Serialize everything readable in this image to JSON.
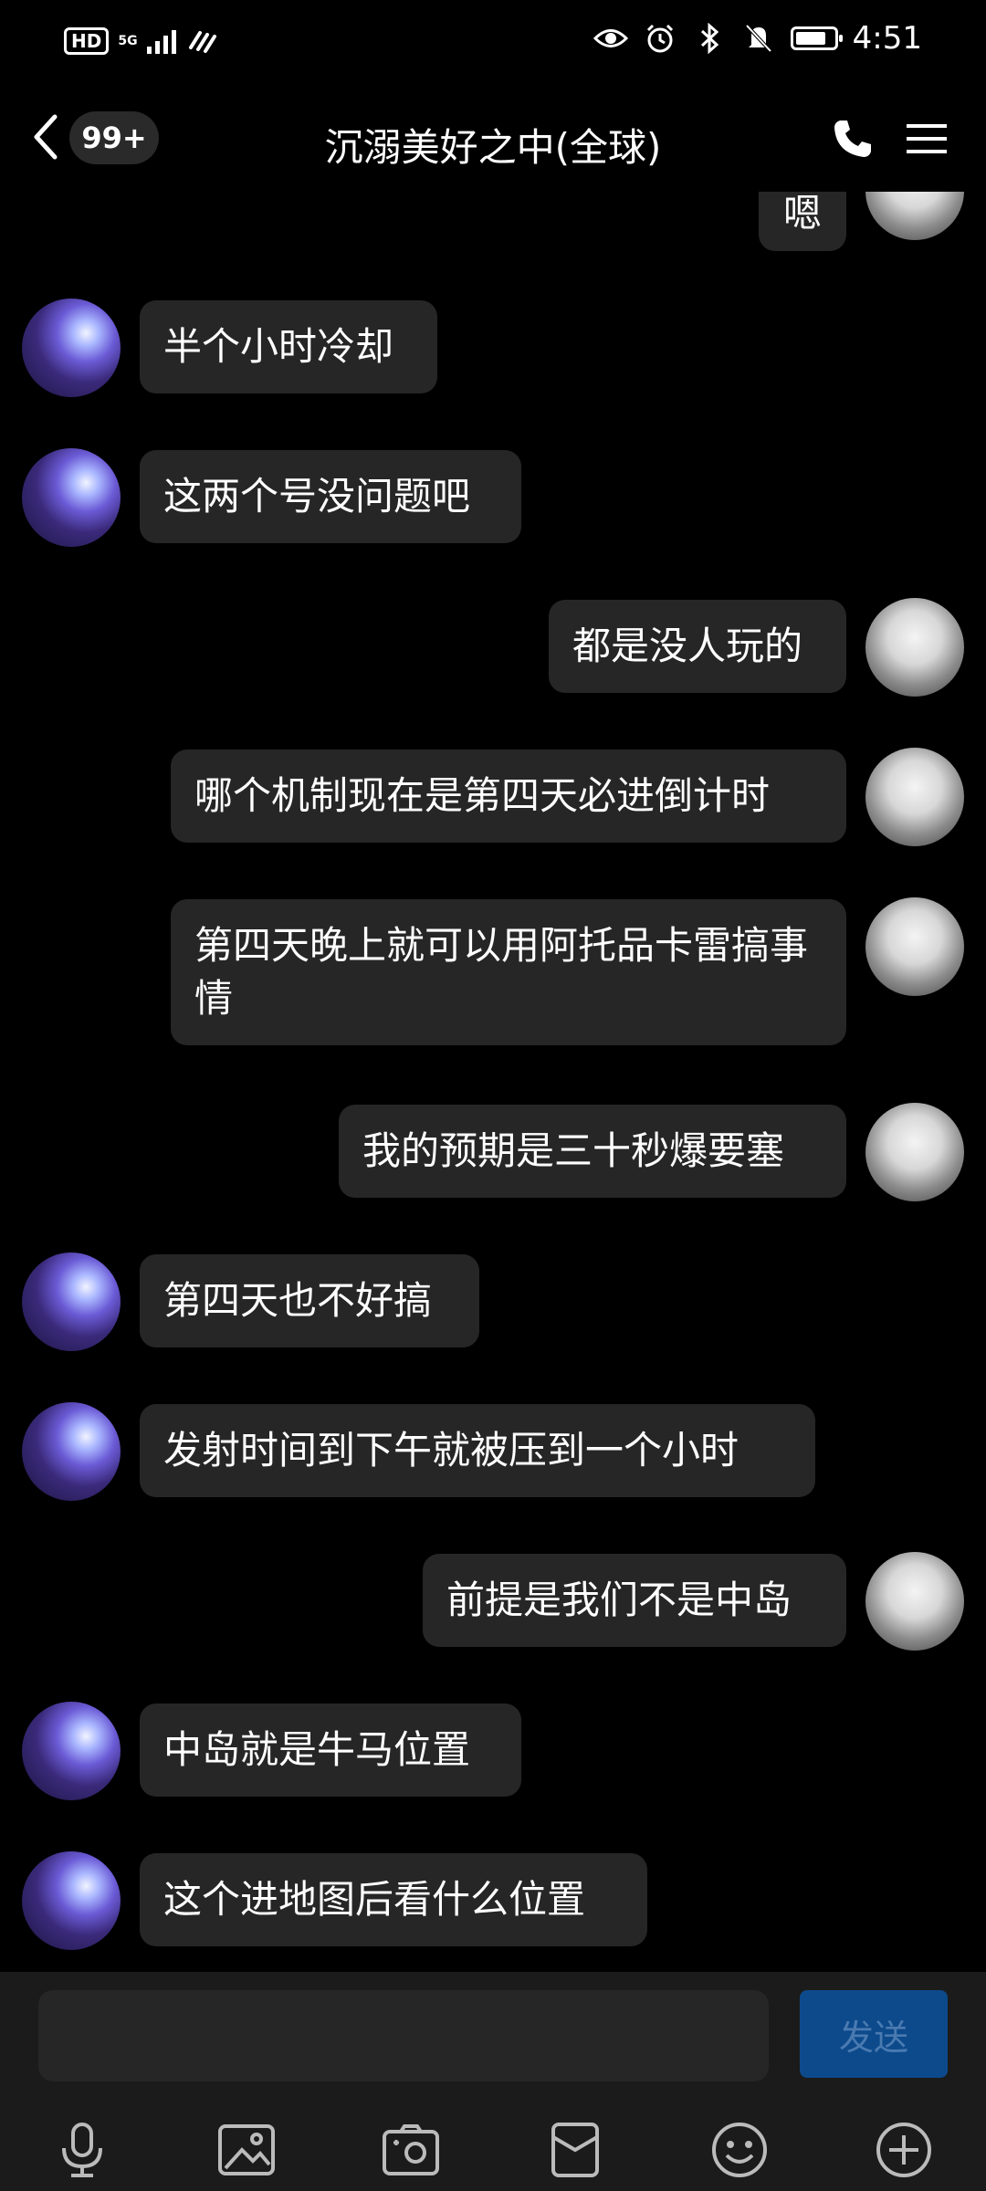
{
  "status_bar": {
    "hd": "HD",
    "network": "5G",
    "time": "4:51"
  },
  "header": {
    "unread_badge": "99+",
    "title": "沉溺美好之中(全球)"
  },
  "messages": [
    {
      "sender": "self",
      "text": "嗯"
    },
    {
      "sender": "other",
      "text": "半个小时冷却"
    },
    {
      "sender": "other",
      "text": "这两个号没问题吧"
    },
    {
      "sender": "self",
      "text": "都是没人玩的"
    },
    {
      "sender": "self",
      "text": "哪个机制现在是第四天必进倒计时"
    },
    {
      "sender": "self",
      "text": "第四天晚上就可以用阿托品卡雷搞事情"
    },
    {
      "sender": "self",
      "text": "我的预期是三十秒爆要塞"
    },
    {
      "sender": "other",
      "text": "第四天也不好搞"
    },
    {
      "sender": "other",
      "text": "发射时间到下午就被压到一个小时"
    },
    {
      "sender": "self",
      "text": "前提是我们不是中岛"
    },
    {
      "sender": "other",
      "text": "中岛就是牛马位置"
    },
    {
      "sender": "other",
      "text": "这个进地图后看什么位置"
    }
  ],
  "input": {
    "value": "",
    "placeholder": ""
  },
  "send_label": "发送",
  "toolbar_icons": [
    "microphone-icon",
    "image-icon",
    "camera-icon",
    "red-packet-icon",
    "emoji-icon",
    "plus-icon"
  ],
  "colors": {
    "background": "#000000",
    "bubble": "#262626",
    "send_button": "#0d4a8c",
    "send_text": "#4a7ab0"
  }
}
